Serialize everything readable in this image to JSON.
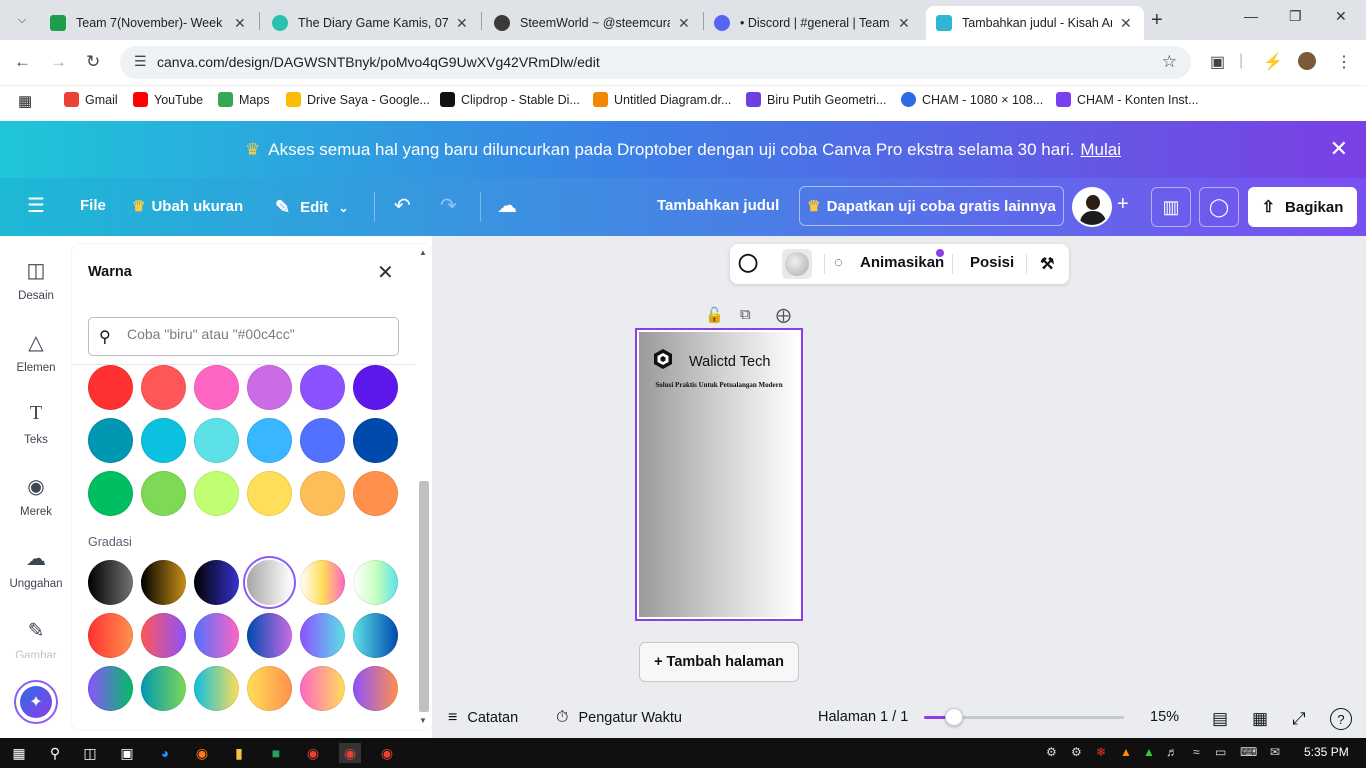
{
  "browser": {
    "tabs": [
      {
        "title": "Team 7(November)- Week -",
        "favicon_color": "#1e9e4a"
      },
      {
        "title": "The Diary Game Kamis, 07 N",
        "favicon_color": "#27c2b0"
      },
      {
        "title": "SteemWorld ~ @steemcurat",
        "favicon_color": "#3a3a3a"
      },
      {
        "title": "• Discord | #general | Team-7",
        "favicon_color": "#5865f2"
      },
      {
        "title": "Tambahkan judul - Kisah An",
        "favicon_color": "#2fb6d6"
      }
    ],
    "url": "canva.com/design/DAGWSNTBnyk/poMvo4qG9UwXVg42VRmDlw/edit",
    "bookmarks": [
      {
        "label": "Gmail",
        "color": "#ea4335"
      },
      {
        "label": "YouTube",
        "color": "#ff0000"
      },
      {
        "label": "Maps",
        "color": "#34a853"
      },
      {
        "label": "Drive Saya - Google...",
        "color": "#fbbc04"
      },
      {
        "label": "Clipdrop - Stable Di...",
        "color": "#111111"
      },
      {
        "label": "Untitled Diagram.dr...",
        "color": "#f08705"
      },
      {
        "label": "Biru Putih Geometri...",
        "color": "#6d3fe0"
      },
      {
        "label": "CHAM - 1080 × 108...",
        "color": "#2d6be4"
      },
      {
        "label": "CHAM - Konten Inst...",
        "color": "#7a3ff0"
      }
    ]
  },
  "promo": {
    "text": "Akses semua hal yang baru diluncurkan pada Droptober dengan uji coba Canva Pro ekstra selama 30 hari.",
    "link": "Mulai"
  },
  "topbar": {
    "file": "File",
    "resize": "Ubah ukuran",
    "edit": "Edit",
    "title": "Tambahkan judul",
    "trial": "Dapatkan uji coba gratis lainnya",
    "share": "Bagikan"
  },
  "rail": [
    {
      "label": "Desain",
      "icon": "layout-icon"
    },
    {
      "label": "Elemen",
      "icon": "shapes-icon"
    },
    {
      "label": "Teks",
      "icon": "text-icon"
    },
    {
      "label": "Merek",
      "icon": "brand-icon"
    },
    {
      "label": "Unggahan",
      "icon": "upload-icon"
    },
    {
      "label": "Gambar",
      "icon": "draw-icon"
    }
  ],
  "panel": {
    "title": "Warna",
    "search_placeholder": "Coba \"biru\" atau \"#00c4cc\"",
    "gradient_label": "Gradasi",
    "solid_colors": [
      [
        "#ff3131",
        "#ff5757",
        "#ff66c4",
        "#cb6ce6",
        "#8c52ff",
        "#5e17eb"
      ],
      [
        "#0097b2",
        "#0cc0df",
        "#5ce1e6",
        "#38b6ff",
        "#5271ff",
        "#004aad"
      ],
      [
        "#00bf63",
        "#7ed957",
        "#c1ff72",
        "#ffde59",
        "#ffbd59",
        "#ff914d"
      ]
    ],
    "gradients": [
      [
        "linear-gradient(90deg,#000000,#737373)",
        "linear-gradient(90deg,#000000,#c89116)",
        "linear-gradient(90deg,#000000,#3533cd)",
        "linear-gradient(90deg,#a6a6a6,#ffffff)",
        "linear-gradient(90deg,#ffffff,#ffde59,#ff66c4)",
        "linear-gradient(90deg,#ffffff,#c9ffbf,#5ce1e6)"
      ],
      [
        "linear-gradient(90deg,#ff3131,#ff914d)",
        "linear-gradient(90deg,#ff5757,#8c52ff)",
        "linear-gradient(90deg,#5170ff,#ff66c4)",
        "linear-gradient(90deg,#004aad,#cb6ce6)",
        "linear-gradient(90deg,#8c52ff,#5ce1e6)",
        "linear-gradient(90deg,#5de0e6,#004aad)"
      ],
      [
        "linear-gradient(90deg,#8c52ff,#00bf63)",
        "linear-gradient(90deg,#0097b2,#7ed957)",
        "linear-gradient(90deg,#0cc0df,#ffde59)",
        "linear-gradient(90deg,#ffde59,#ff914d)",
        "linear-gradient(90deg,#ff66c4,#ffde59)",
        "linear-gradient(90deg,#8c52ff,#ff914d)"
      ]
    ],
    "selected_gradient": [
      0,
      3
    ]
  },
  "context_toolbar": {
    "animate": "Animasikan",
    "position": "Posisi"
  },
  "canvas": {
    "brand_name": "Walictd Tech",
    "tagline": "Solusi Praktis Untuk Petualangan Modern",
    "add_page": "+ Tambah halaman"
  },
  "bottombar": {
    "notes": "Catatan",
    "timer": "Pengatur Waktu",
    "page_indicator": "Halaman 1 / 1",
    "zoom": "15%",
    "zoom_level": 0.15
  },
  "taskbar": {
    "time": "5:35 PM"
  }
}
